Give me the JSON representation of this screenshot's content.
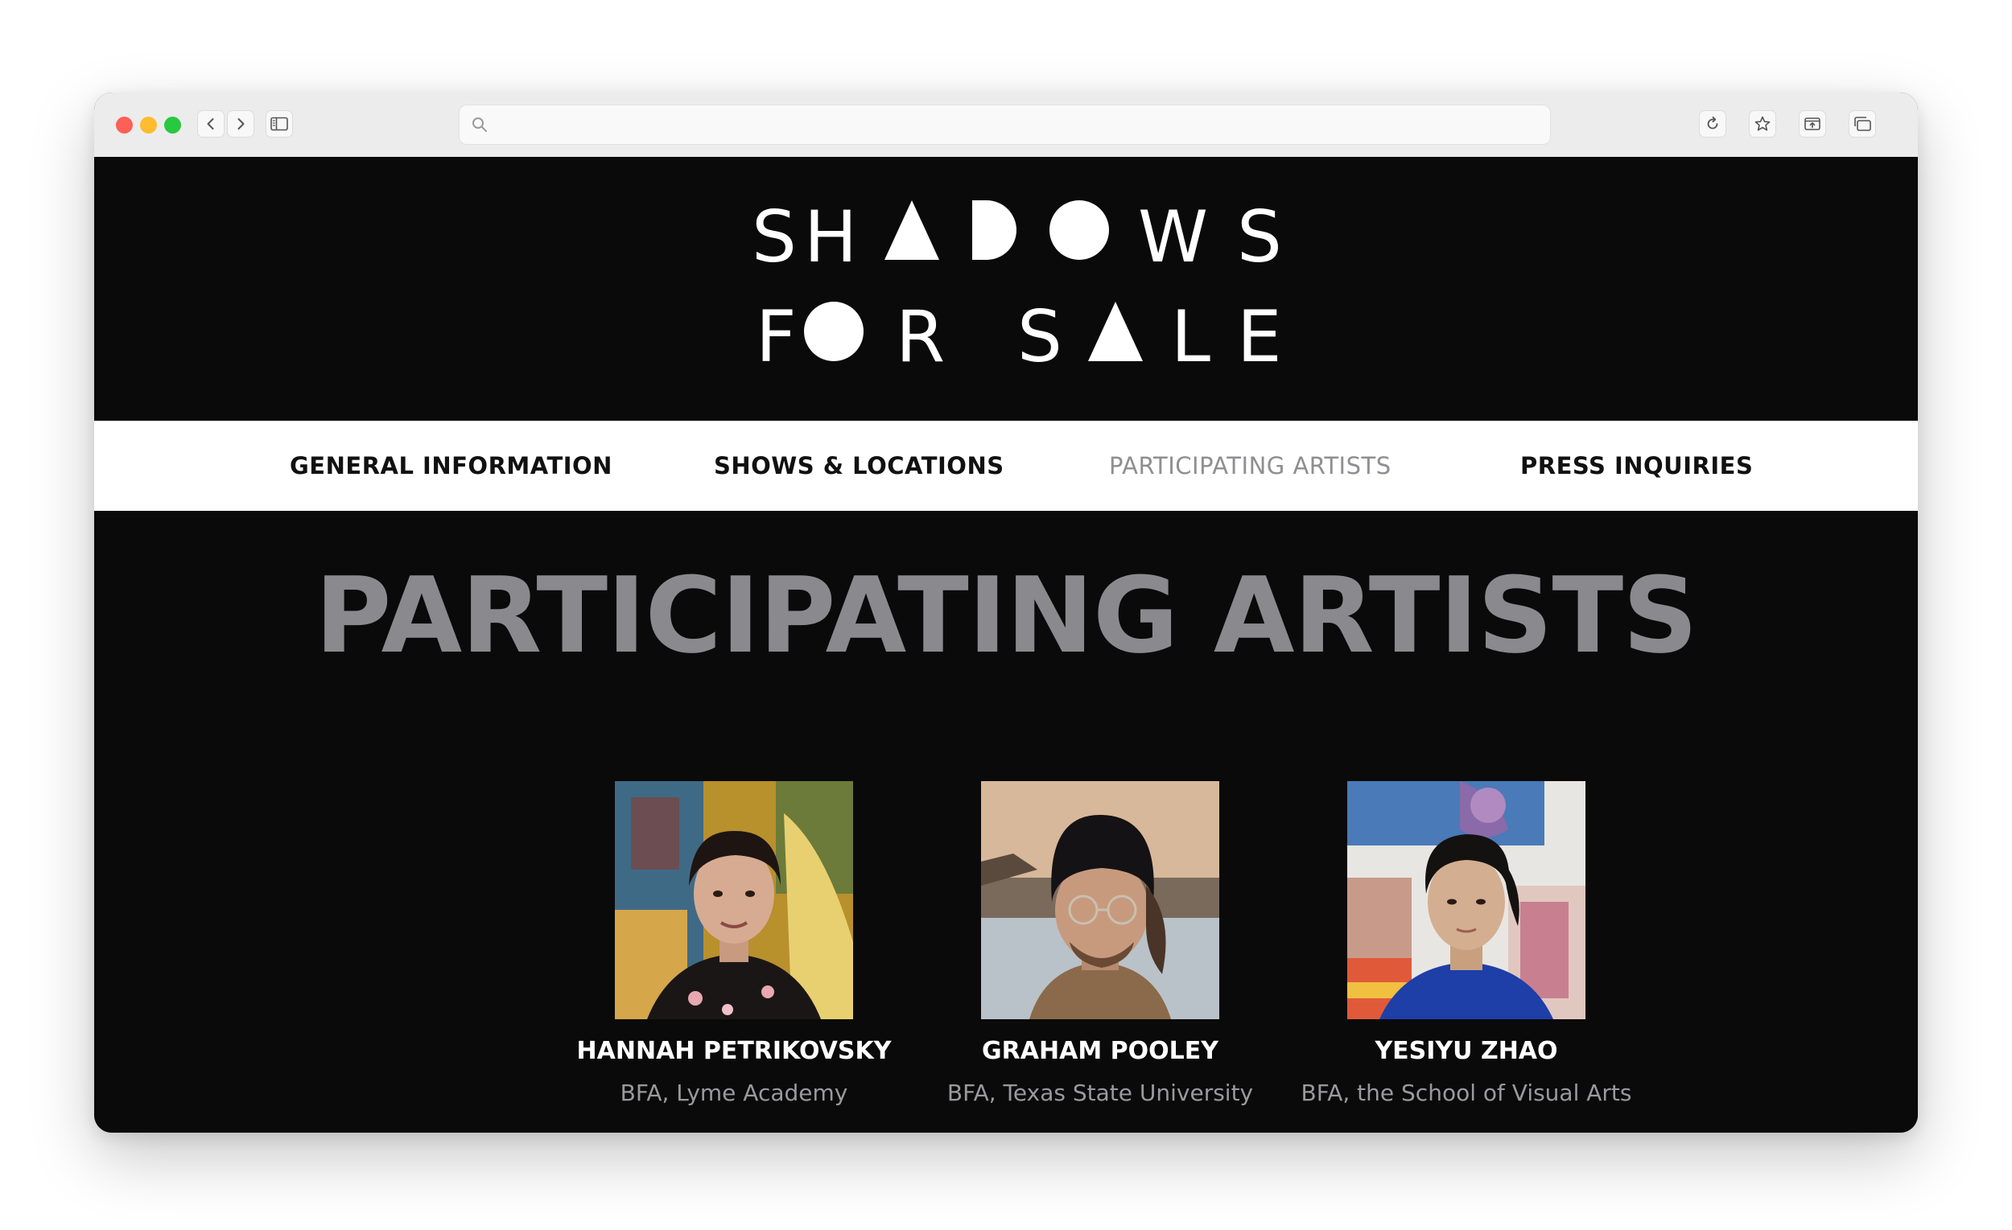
{
  "browser": {
    "address": "",
    "icons": [
      "back-icon",
      "forward-icon",
      "sidebar-icon",
      "search-icon",
      "reload-icon",
      "bookmark-star-icon",
      "share-icon",
      "tabs-icon"
    ]
  },
  "site": {
    "logo_line1": "SHADOWS",
    "logo_line2": "FOR SALE"
  },
  "nav": {
    "items": [
      {
        "label": "GENERAL INFORMATION"
      },
      {
        "label": "SHOWS & LOCATIONS"
      },
      {
        "label": "PARTICIPATING ARTISTS",
        "active": true
      },
      {
        "label": "PRESS INQUIRIES"
      }
    ]
  },
  "main": {
    "title": "PARTICIPATING ARTISTS",
    "artists": [
      {
        "name": "HANNAH PETRIKOVSKY",
        "school": "BFA, Lyme Academy"
      },
      {
        "name": "GRAHAM POOLEY",
        "school": "BFA, Texas State University"
      },
      {
        "name": "YESIYU ZHAO",
        "school": "BFA, the School of Visual Arts"
      }
    ]
  },
  "colors": {
    "background": "#0a0a0a",
    "nav_background": "#ffffff",
    "title_gray": "#8a8a8e",
    "active_nav_gray": "#8e8e93",
    "school_gray": "#9a9a9e"
  }
}
